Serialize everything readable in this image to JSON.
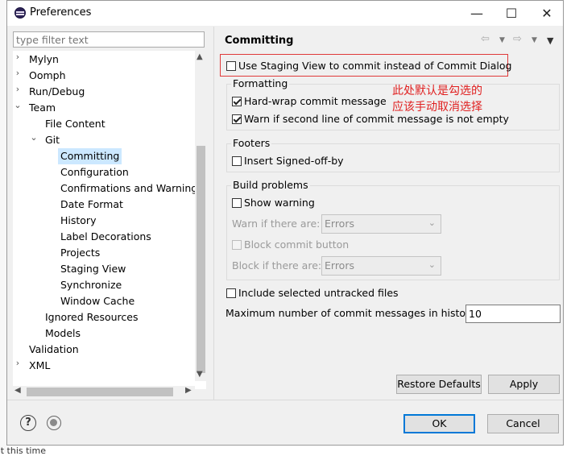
{
  "window": {
    "title": "Preferences",
    "minimize": "—",
    "maximize": "☐",
    "close": "✕"
  },
  "filter": {
    "placeholder": "type filter text"
  },
  "tree": {
    "items": [
      {
        "label": "Mylyn",
        "level": 0,
        "chevron": "›"
      },
      {
        "label": "Oomph",
        "level": 0,
        "chevron": "›"
      },
      {
        "label": "Run/Debug",
        "level": 0,
        "chevron": "›"
      },
      {
        "label": "Team",
        "level": 0,
        "chevron": "⌄"
      },
      {
        "label": "File Content",
        "level": 1,
        "chevron": ""
      },
      {
        "label": "Git",
        "level": 1,
        "chevron": "⌄"
      },
      {
        "label": "Committing",
        "level": 2,
        "chevron": "",
        "selected": true
      },
      {
        "label": "Configuration",
        "level": 2,
        "chevron": ""
      },
      {
        "label": "Confirmations and Warnings",
        "level": 2,
        "chevron": ""
      },
      {
        "label": "Date Format",
        "level": 2,
        "chevron": ""
      },
      {
        "label": "History",
        "level": 2,
        "chevron": ""
      },
      {
        "label": "Label Decorations",
        "level": 2,
        "chevron": ""
      },
      {
        "label": "Projects",
        "level": 2,
        "chevron": ""
      },
      {
        "label": "Staging View",
        "level": 2,
        "chevron": ""
      },
      {
        "label": "Synchronize",
        "level": 2,
        "chevron": ""
      },
      {
        "label": "Window Cache",
        "level": 2,
        "chevron": ""
      },
      {
        "label": "Ignored Resources",
        "level": 1,
        "chevron": ""
      },
      {
        "label": "Models",
        "level": 1,
        "chevron": ""
      },
      {
        "label": "Validation",
        "level": 0,
        "chevron": ""
      },
      {
        "label": "XML",
        "level": 0,
        "chevron": "›"
      }
    ]
  },
  "page": {
    "title": "Committing",
    "use_staging_view": "Use Staging View to commit instead of Commit Dialog",
    "formatting": {
      "label": "Formatting",
      "hard_wrap": "Hard-wrap commit message",
      "warn_second_line": "Warn if second line of commit message is not empty"
    },
    "footers": {
      "label": "Footers",
      "signed_off": "Insert Signed-off-by"
    },
    "build_problems": {
      "label": "Build problems",
      "show_warning": "Show warning",
      "warn_if_label": "Warn if there are:",
      "warn_if_value": "Errors",
      "block_commit": "Block commit button",
      "block_if_label": "Block if there are:",
      "block_if_value": "Errors"
    },
    "include_untracked": "Include selected untracked files",
    "max_messages_label": "Maximum number of commit messages in history:",
    "max_messages_value": "10",
    "restore_defaults": "Restore Defaults",
    "apply": "Apply"
  },
  "annotation": {
    "line1": "此处默认是勾选的",
    "line2": "应该手动取消选择"
  },
  "footer": {
    "ok": "OK",
    "cancel": "Cancel"
  },
  "background": {
    "bottom_text": "at this time"
  }
}
